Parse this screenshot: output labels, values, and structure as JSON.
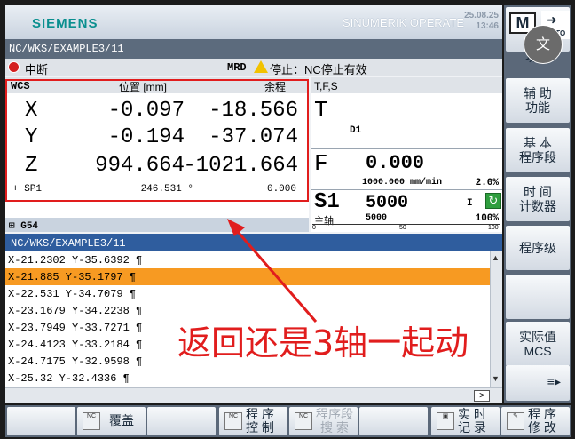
{
  "header": {
    "brand": "SIEMENS",
    "product": "SINUMERIK OPERATE",
    "date": "25.08.25",
    "time": "13:46"
  },
  "path": "NC/WKS/EXAMPLE3/11",
  "alarm": {
    "text": "中断",
    "mode": "MRD",
    "stop_text": "停止：NC停止有效"
  },
  "wcs": {
    "title": "WCS",
    "pos_header": "位置 [mm]",
    "rem_header": "余程",
    "axes": [
      {
        "name": "X",
        "pos": "-0.097",
        "rem": "-18.566"
      },
      {
        "name": "Y",
        "pos": "-0.194",
        "rem": "-37.074"
      },
      {
        "name": "Z",
        "pos": "994.664",
        "rem": "-1021.664"
      }
    ],
    "spindle": {
      "name": "+ SP1",
      "pos": "246.531 °",
      "rem": "0.000"
    },
    "g_code": "G54"
  },
  "tfs": {
    "header": "T,F,S",
    "t_letter": "T",
    "d_value": "D1",
    "f_letter": "F",
    "f_value": "0.000",
    "f_line": "1000.000 mm/min",
    "f_pct": "2.0%",
    "s_letter": "S1",
    "s_value": "5000",
    "s_dir": "I",
    "spindle_label": "主轴",
    "s_actual": "5000",
    "s_pct": "100%",
    "scale": [
      "0",
      "50",
      "100"
    ]
  },
  "program": {
    "title": "NC/WKS/EXAMPLE3/11",
    "lines": [
      "X-21.2302 Y-35.6392 ¶",
      "X-21.885 Y-35.1797 ¶",
      "X-22.531 Y-34.7079 ¶",
      "X-23.1679 Y-34.2238 ¶",
      "X-23.7949 Y-33.7271 ¶",
      "X-24.4123 Y-33.2184 ¶",
      "X-24.7175 Y-32.9598 ¶",
      "X-25.32 Y-32.4336 ¶"
    ],
    "selected_index": 1
  },
  "vertical_softkeys": {
    "m_key": "M",
    "auto_key": "AUTO",
    "translate": "文",
    "items": [
      "功能",
      "辅 助\n功能",
      "基 本\n程序段",
      "时 间\n计数器",
      "程序级",
      "",
      "实际值\nMCS",
      ""
    ]
  },
  "horizontal_softkeys": {
    "overwrite": "覆盖",
    "prog_control": "程 序\n控 制",
    "prog_search": "程序段\n搜 索",
    "realtime_record": "实 时\n记 录",
    "prog_edit": "程 序\n修 改"
  },
  "annotation": "返回还是3轴一起动",
  "colors": {
    "accent_red": "#e11d1d",
    "selection": "#f79a22",
    "header_blue": "#2f5d9e"
  }
}
